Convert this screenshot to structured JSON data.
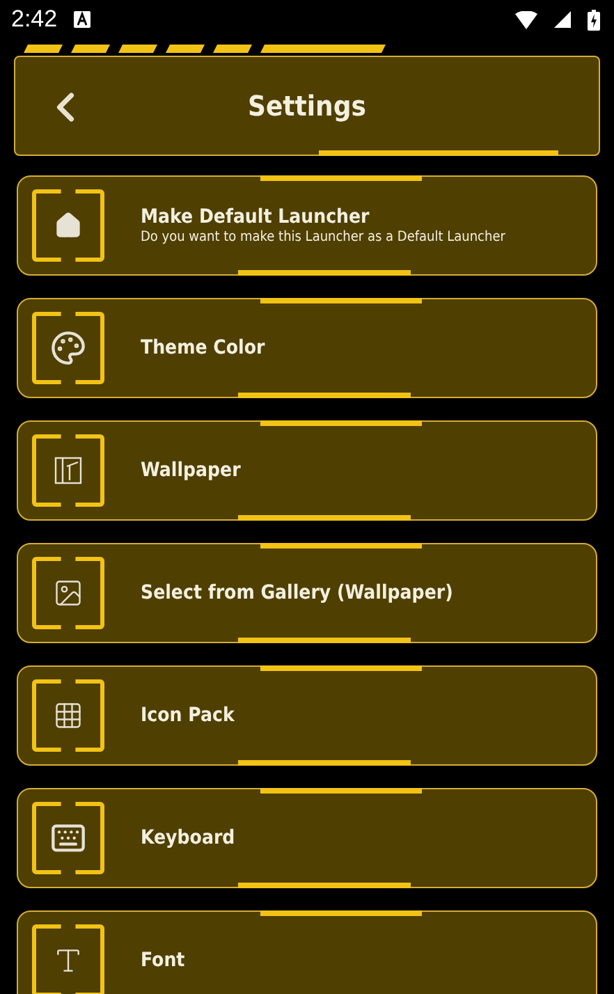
{
  "status_bar": {
    "time": "2:42"
  },
  "header": {
    "title": "Settings"
  },
  "items": [
    {
      "title": "Make Default Launcher",
      "subtitle": "Do you want to make this Launcher as a Default Launcher"
    },
    {
      "title": "Theme Color"
    },
    {
      "title": "Wallpaper"
    },
    {
      "title": "Select from Gallery (Wallpaper)"
    },
    {
      "title": "Icon Pack"
    },
    {
      "title": "Keyboard"
    },
    {
      "title": "Font"
    }
  ]
}
